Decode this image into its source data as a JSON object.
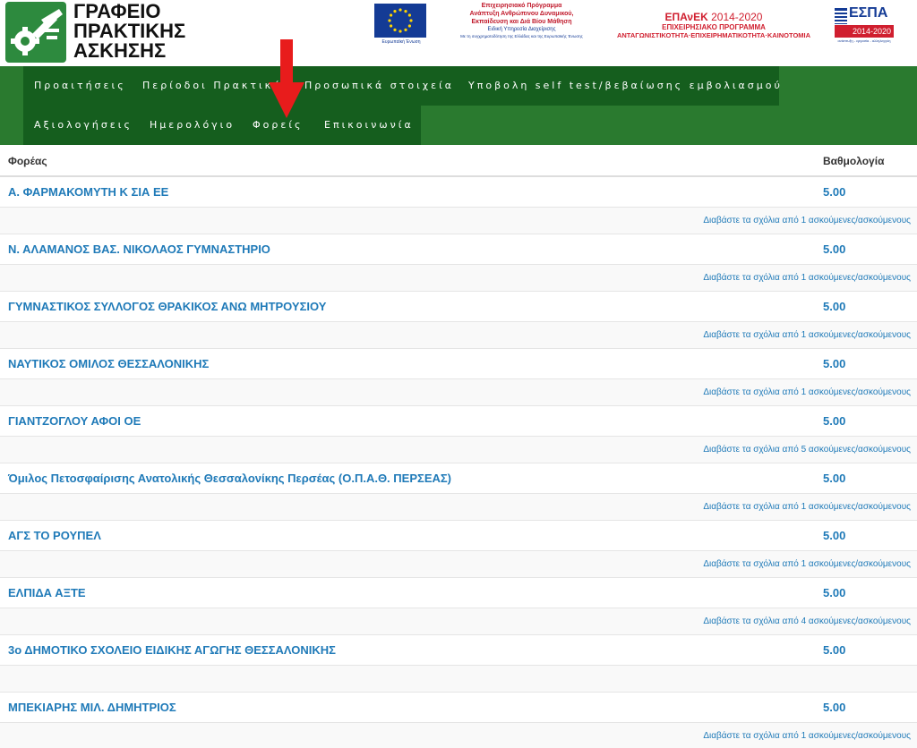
{
  "logo": {
    "lines": [
      "ΓΡΑΦΕΙΟ",
      "ΠΡΑΚΤΙΚΗΣ",
      "ΑΣΚΗΣΗΣ"
    ],
    "icon": "tools-gear-icon"
  },
  "sponsors": {
    "eu_caption": "Ευρωπαϊκή Ένωση",
    "epan_lines": [
      "Επιχειρησιακό Πρόγραμμα",
      "Ανάπτυξη Ανθρώπινου Δυναμικού,",
      "Εκπαίδευση και Διά Βίου Μάθηση",
      "Ειδική Υπηρεσία Διαχείρισης",
      "Με τη συγχρηματοδότηση της Ελλάδας και της Ευρωπαϊκής Ένωσης"
    ],
    "epanek_title": "ΕΠΑνΕΚ",
    "epanek_years": "2014-2020",
    "epanek_sub1": "ΕΠΙΧΕΙΡΗΣΙΑΚΟ ΠΡΟΓΡΑΜΜΑ",
    "epanek_sub2": "ΑΝΤΑΓΩΝΙΣΤΙΚΟΤΗΤΑ·ΕΠΙΧΕΙΡΗΜΑΤΙΚΟΤΗΤΑ·ΚΑΙΝΟΤΟΜΙΑ",
    "espa_title": "ΕΣΠΑ",
    "espa_years": "2014-2020",
    "espa_caption": "ανάπτυξη - εργασία - αλληλεγγύη"
  },
  "nav": {
    "row1": [
      "Προαιτήσεις",
      "Περίοδοι Πρακτικής",
      "Προσωπικά στοιχεία",
      "Υποβολη self test/βεβαίωσης εμβολιασμού"
    ],
    "row2": [
      "Αξιολογήσεις",
      "Ημερολόγιο",
      "Φορείς",
      "Επικοινωνία"
    ]
  },
  "table": {
    "headers": {
      "org": "Φορέας",
      "score": "Βαθμολογία"
    },
    "rows": [
      {
        "name": "Α. ΦΑΡΜΑΚΟΜΥΤΗ Κ ΣΙΑ ΕΕ",
        "score": "5.00",
        "comments": "Διαβάστε τα σχόλια από 1 ασκούμενες/ασκούμενους"
      },
      {
        "name": "Ν. ΑΛΑΜΑΝΟΣ ΒΑΣ. ΝΙΚΟΛΑΟΣ ΓΥΜΝΑΣΤΗΡΙΟ",
        "score": "5.00",
        "comments": "Διαβάστε τα σχόλια από 1 ασκούμενες/ασκούμενους"
      },
      {
        "name": "ΓΥΜΝΑΣΤΙΚΟΣ ΣΥΛΛΟΓΟΣ ΘΡΑΚΙΚΟΣ ΑΝΩ ΜΗΤΡΟΥΣΙΟΥ",
        "score": "5.00",
        "comments": "Διαβάστε τα σχόλια από 1 ασκούμενες/ασκούμενους"
      },
      {
        "name": "ΝΑΥΤΙΚΟΣ ΟΜΙΛΟΣ ΘΕΣΣΑΛΟΝΙΚΗΣ",
        "score": "5.00",
        "comments": "Διαβάστε τα σχόλια από 1 ασκούμενες/ασκούμενους"
      },
      {
        "name": "ΓΙΑΝΤΖΟΓΛΟΥ ΑΦΟΙ ΟΕ",
        "score": "5.00",
        "comments": "Διαβάστε τα σχόλια από 5 ασκούμενες/ασκούμενους"
      },
      {
        "name": "Όμιλος Πετοσφαίρισης Ανατολικής Θεσσαλονίκης Περσέας (Ο.Π.Α.Θ. ΠΕΡΣΕΑΣ)",
        "score": "5.00",
        "comments": "Διαβάστε τα σχόλια από 1 ασκούμενες/ασκούμενους"
      },
      {
        "name": "ΑΓΣ ΤΟ ΡΟΥΠΕΛ",
        "score": "5.00",
        "comments": "Διαβάστε τα σχόλια από 1 ασκούμενες/ασκούμενους"
      },
      {
        "name": "ΕΛΠΙΔΑ ΑΞΤΕ",
        "score": "5.00",
        "comments": "Διαβάστε τα σχόλια από 4 ασκούμενες/ασκούμενους"
      },
      {
        "name": "3ο ΔΗΜΟΤΙΚΟ ΣΧΟΛΕΙΟ ΕΙΔΙΚΗΣ ΑΓΩΓΗΣ ΘΕΣΣΑΛΟΝΙΚΗΣ",
        "score": "5.00",
        "comments": ""
      },
      {
        "name": "ΜΠΕΚΙΑΡΗΣ ΜΙΛ. ΔΗΜΗΤΡΙΟΣ",
        "score": "5.00",
        "comments": "Διαβάστε τα σχόλια από 1 ασκούμενες/ασκούμενους"
      }
    ]
  },
  "annotation": {
    "icon": "red-arrow-down-icon",
    "color": "#e81c1c"
  },
  "colors": {
    "nav_bg": "#2a7a2f",
    "nav_item_bg": "#155e1e",
    "link": "#1f7ab8"
  }
}
